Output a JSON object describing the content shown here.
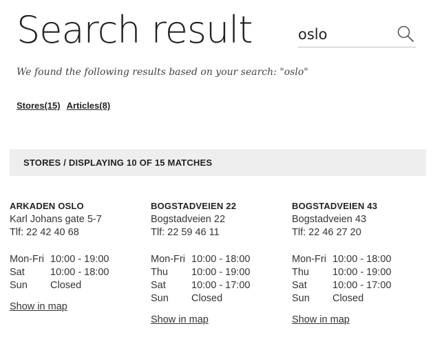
{
  "page": {
    "title": "Search result"
  },
  "search": {
    "value": "oslo",
    "icon": "search-icon"
  },
  "subtitle": "We found the following results based on your search: \"oslo\"",
  "filters": {
    "stores": "Stores(15)",
    "articles": "Articles(8)"
  },
  "stores_bar": {
    "label": "STORES / DISPLAYING 10 OF 15 MATCHES"
  },
  "stores": [
    {
      "name": "ARKADEN OSLO",
      "address": "Karl Johans gate 5-7",
      "phone": "Tlf: 22 42 40 68",
      "hours": [
        {
          "day": "Mon-Fri",
          "time": "10:00 - 19:00"
        },
        {
          "day": "Sat",
          "time": "10:00 - 18:00"
        },
        {
          "day": "Sun",
          "time": "Closed"
        }
      ],
      "map_link": "Show in map"
    },
    {
      "name": "BOGSTADVEIEN 22",
      "address": "Bogstadveien 22",
      "phone": "Tlf: 22 59 46 11",
      "hours": [
        {
          "day": "Mon-Fri",
          "time": "10:00 - 18:00"
        },
        {
          "day": "Thu",
          "time": "10:00 - 19:00"
        },
        {
          "day": "Sat",
          "time": "10:00 - 17:00"
        },
        {
          "day": "Sun",
          "time": "Closed"
        }
      ],
      "map_link": "Show in map"
    },
    {
      "name": "BOGSTADVEIEN 43",
      "address": "Bogstadveien 43",
      "phone": "Tlf: 22 46 27 20",
      "hours": [
        {
          "day": "Mon-Fri",
          "time": "10:00 - 18:00"
        },
        {
          "day": "Thu",
          "time": "10:00 - 19:00"
        },
        {
          "day": "Sat",
          "time": "10:00 - 17:00"
        },
        {
          "day": "Sun",
          "time": "Closed"
        }
      ],
      "map_link": "Show in map"
    }
  ]
}
